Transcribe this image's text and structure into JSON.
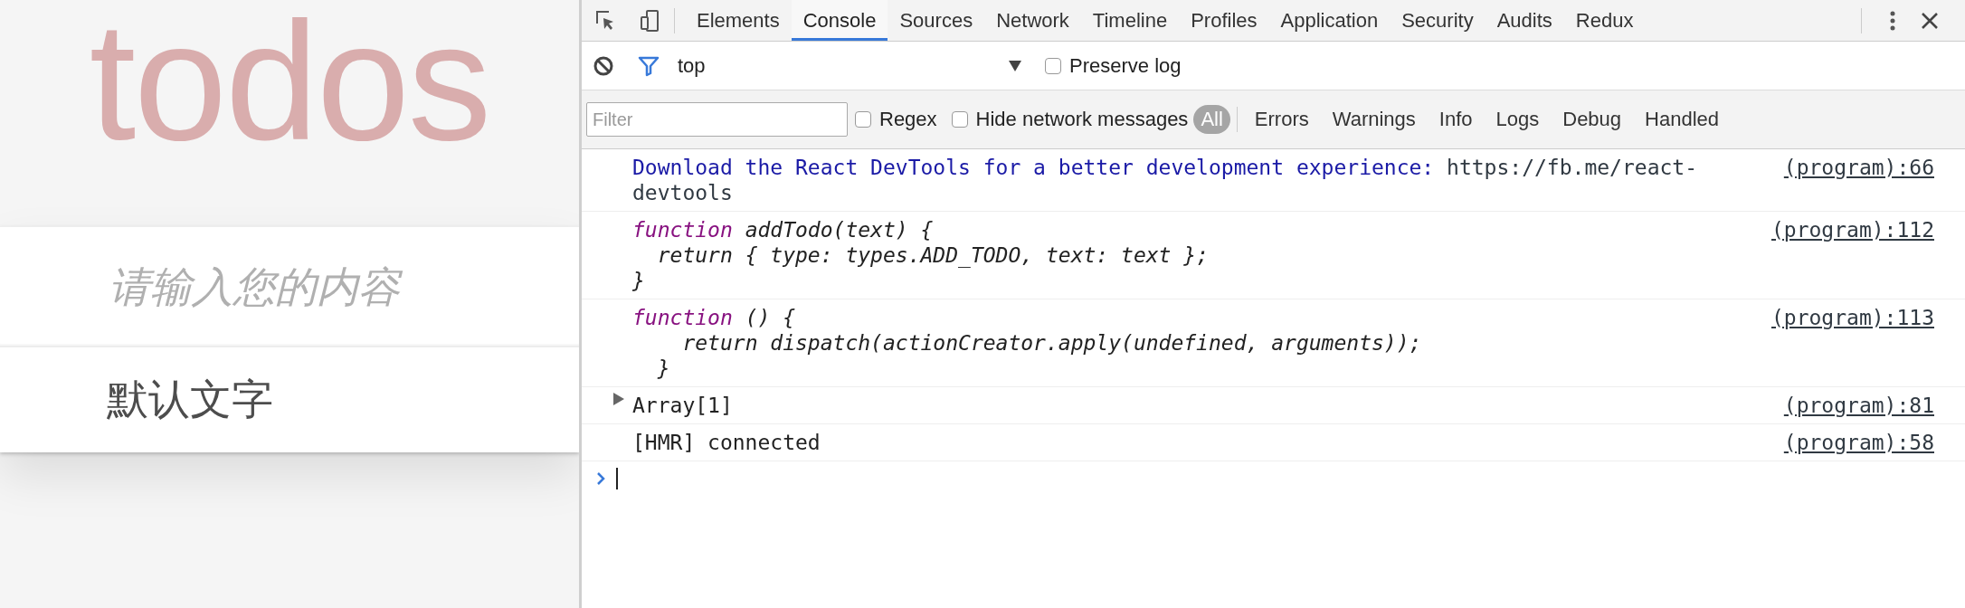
{
  "todo_app": {
    "title": "todos",
    "new_todo": {
      "placeholder": "请输入您的内容"
    },
    "items": [
      {
        "text": "默认文字"
      }
    ]
  },
  "devtools": {
    "tabs": [
      {
        "label": "Elements",
        "selected": false
      },
      {
        "label": "Console",
        "selected": true
      },
      {
        "label": "Sources",
        "selected": false
      },
      {
        "label": "Network",
        "selected": false
      },
      {
        "label": "Timeline",
        "selected": false
      },
      {
        "label": "Profiles",
        "selected": false
      },
      {
        "label": "Application",
        "selected": false
      },
      {
        "label": "Security",
        "selected": false
      },
      {
        "label": "Audits",
        "selected": false
      },
      {
        "label": "Redux",
        "selected": false
      }
    ],
    "context": {
      "value": "top"
    },
    "preserve_log": {
      "label": "Preserve log",
      "checked": false
    },
    "filter": {
      "placeholder": "Filter"
    },
    "regex": {
      "label": "Regex",
      "checked": false
    },
    "hide_network": {
      "label": "Hide network messages",
      "checked": false
    },
    "levels": [
      {
        "label": "All",
        "selected": true
      },
      {
        "label": "Errors",
        "selected": false
      },
      {
        "label": "Warnings",
        "selected": false
      },
      {
        "label": "Info",
        "selected": false
      },
      {
        "label": "Logs",
        "selected": false
      },
      {
        "label": "Debug",
        "selected": false
      },
      {
        "label": "Handled",
        "selected": false
      }
    ],
    "messages": [
      {
        "kind": "info",
        "text": "Download the React DevTools for a better development experience:",
        "link": "https://fb.me/react-devtools",
        "source": "(program):66"
      },
      {
        "kind": "function",
        "keyword": "function",
        "lines": [
          "addTodo(text) {",
          "  return { type: types.ADD_TODO, text: text };",
          "}"
        ],
        "source": "(program):112"
      },
      {
        "kind": "function",
        "keyword": "function",
        "lines": [
          "() {",
          "    return dispatch(actionCreator.apply(undefined, arguments));",
          "  }"
        ],
        "source": "(program):113"
      },
      {
        "kind": "object",
        "text": "Array[1]",
        "expanded": false,
        "source": "(program):81"
      },
      {
        "kind": "log",
        "text": "[HMR] connected",
        "source": "(program):58"
      }
    ]
  }
}
